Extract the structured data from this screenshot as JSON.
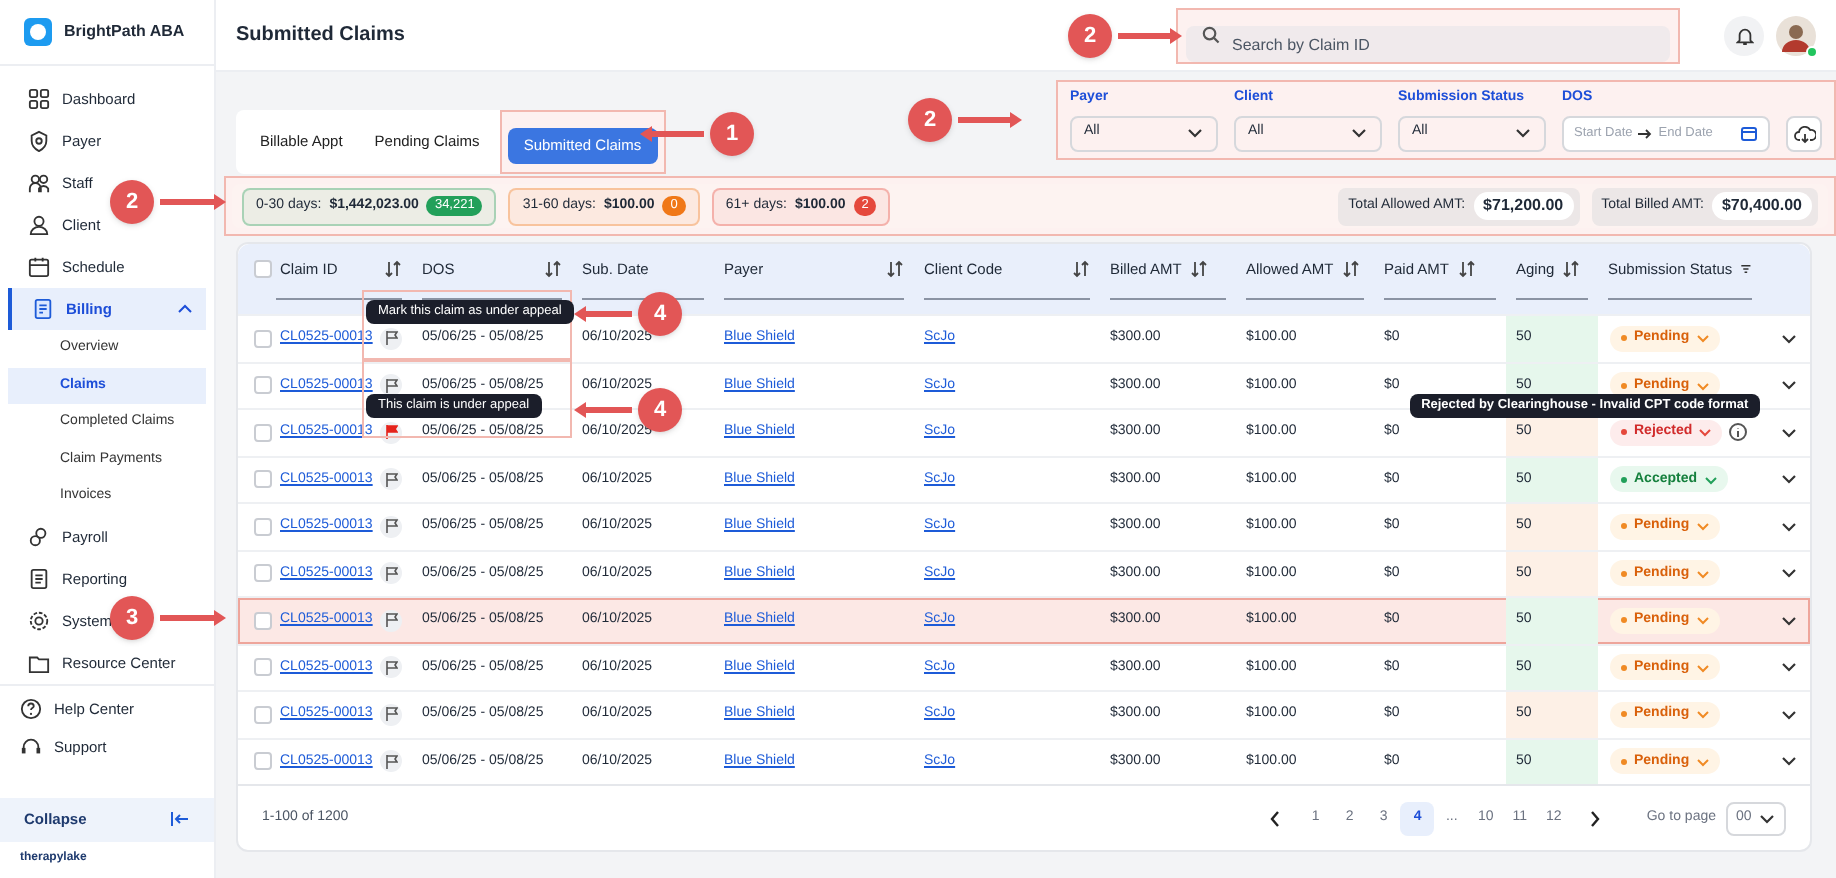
{
  "sidebar": {
    "brand": "BrightPath ABA",
    "items": [
      {
        "label": "Dashboard",
        "selected": false
      },
      {
        "label": "Payer",
        "selected": false
      },
      {
        "label": "Staff",
        "selected": false
      },
      {
        "label": "Client",
        "selected": false
      },
      {
        "label": "Schedule",
        "selected": false
      },
      {
        "label": "Billing",
        "selected": true,
        "expanded": true,
        "children": [
          {
            "label": "Overview",
            "selected": false
          },
          {
            "label": "Claims",
            "selected": true
          },
          {
            "label": "Completed Claims",
            "selected": false
          },
          {
            "label": "Claim Payments",
            "selected": false
          },
          {
            "label": "Invoices",
            "selected": false
          }
        ]
      },
      {
        "label": "Payroll",
        "selected": false
      },
      {
        "label": "Reporting",
        "selected": false
      },
      {
        "label": "System",
        "selected": false
      },
      {
        "label": "Resource Center",
        "selected": false
      }
    ],
    "footer_items": [
      {
        "label": "Help Center"
      },
      {
        "label": "Support"
      }
    ],
    "collapse": "Collapse",
    "vendor": "therapylake"
  },
  "header": {
    "title": "Submitted Claims",
    "search": {
      "placeholder": "Search by Claim ID"
    }
  },
  "tabs": [
    {
      "label": "Billable Appt",
      "selected": false
    },
    {
      "label": "Pending Claims",
      "selected": false
    },
    {
      "label": "Submitted Claims",
      "selected": true
    }
  ],
  "filters": [
    {
      "label": "Payer",
      "value": "All"
    },
    {
      "label": "Client",
      "value": "All"
    },
    {
      "label": "Submission Status",
      "value": "All"
    }
  ],
  "dos_filter": {
    "label": "DOS",
    "start_placeholder": "Start Date",
    "end_placeholder": "End Date"
  },
  "aging_buckets": [
    {
      "label": "0-30 days:",
      "amount": "$1,442,023.00",
      "count": "34,221",
      "color": "#22a05a"
    },
    {
      "label": "31-60 days:",
      "amount": "$100.00",
      "count": "0",
      "color": "#f07818"
    },
    {
      "label": "61+ days:",
      "amount": "$100.00",
      "count": "2",
      "color": "#e5483c"
    }
  ],
  "totals": [
    {
      "label": "Total Allowed AMT:",
      "value": "$71,200.00"
    },
    {
      "label": "Total Billed AMT:",
      "value": "$70,400.00"
    }
  ],
  "table": {
    "all_checked": false,
    "columns": [
      "Claim ID",
      "DOS",
      "Sub. Date",
      "Payer",
      "Client Code",
      "Billed AMT",
      "Allowed AMT",
      "Paid AMT",
      "Aging",
      "Submission Status"
    ],
    "rows": [
      {
        "checked": false,
        "claim_id": "CL0525-00013",
        "appealed": false,
        "flag_tooltip": "Mark this claim as under appeal",
        "dos": "05/06/25 - 05/08/25",
        "sub_date": "06/10/2025",
        "payer": "Blue Shield",
        "client_code": "ScJo",
        "billed": "$300.00",
        "allowed": "$100.00",
        "paid": "$0",
        "aging": "50",
        "color": "#e6f7ec",
        "status": {
          "kind": "pending",
          "label": "Pending"
        },
        "highlighted": false
      },
      {
        "checked": false,
        "claim_id": "CL0525-00013",
        "appealed": false,
        "dos": "05/06/25 - 05/08/25",
        "sub_date": "06/10/2025",
        "payer": "Blue Shield",
        "client_code": "ScJo",
        "billed": "$300.00",
        "allowed": "$100.00",
        "paid": "$0",
        "aging": "50",
        "color": "#e6f7ec",
        "status": {
          "kind": "pending",
          "label": "Pending"
        },
        "highlighted": false
      },
      {
        "checked": false,
        "claim_id": "CL0525-00013",
        "appealed": true,
        "flag_tooltip": "This claim is under appeal",
        "dos": "05/06/25 - 05/08/25",
        "sub_date": "06/10/2025",
        "payer": "Blue Shield",
        "client_code": "ScJo",
        "billed": "$300.00",
        "allowed": "$100.00",
        "paid": "$0",
        "aging": "50",
        "color": "#fdf0e6",
        "status": {
          "kind": "rejected",
          "label": "Rejected"
        },
        "status_tooltip": "Rejected by Clearinghouse - Invalid CPT code format",
        "highlighted": false
      },
      {
        "checked": false,
        "claim_id": "CL0525-00013",
        "appealed": false,
        "dos": "05/06/25 - 05/08/25",
        "sub_date": "06/10/2025",
        "payer": "Blue Shield",
        "client_code": "ScJo",
        "billed": "$300.00",
        "allowed": "$100.00",
        "paid": "$0",
        "aging": "50",
        "color": "#e6f7ec",
        "status": {
          "kind": "accepted",
          "label": "Accepted"
        },
        "highlighted": false
      },
      {
        "checked": false,
        "claim_id": "CL0525-00013",
        "appealed": false,
        "dos": "05/06/25 - 05/08/25",
        "sub_date": "06/10/2025",
        "payer": "Blue Shield",
        "client_code": "ScJo",
        "billed": "$300.00",
        "allowed": "$100.00",
        "paid": "$0",
        "aging": "50",
        "color": "#fdf0e6",
        "status": {
          "kind": "pending",
          "label": "Pending"
        },
        "highlighted": false
      },
      {
        "checked": false,
        "claim_id": "CL0525-00013",
        "appealed": false,
        "dos": "05/06/25 - 05/08/25",
        "sub_date": "06/10/2025",
        "payer": "Blue Shield",
        "client_code": "ScJo",
        "billed": "$300.00",
        "allowed": "$100.00",
        "paid": "$0",
        "aging": "50",
        "color": "#fdf0e6",
        "status": {
          "kind": "pending",
          "label": "Pending"
        },
        "highlighted": false
      },
      {
        "checked": false,
        "claim_id": "CL0525-00013",
        "appealed": false,
        "dos": "05/06/25 - 05/08/25",
        "sub_date": "06/10/2025",
        "payer": "Blue Shield",
        "client_code": "ScJo",
        "billed": "$300.00",
        "allowed": "$100.00",
        "paid": "$0",
        "aging": "50",
        "color": "#e6f7ec",
        "status": {
          "kind": "pending",
          "label": "Pending"
        },
        "highlighted": true
      },
      {
        "checked": false,
        "claim_id": "CL0525-00013",
        "appealed": false,
        "dos": "05/06/25 - 05/08/25",
        "sub_date": "06/10/2025",
        "payer": "Blue Shield",
        "client_code": "ScJo",
        "billed": "$300.00",
        "allowed": "$100.00",
        "paid": "$0",
        "aging": "50",
        "color": "#e6f7ec",
        "status": {
          "kind": "pending",
          "label": "Pending"
        },
        "highlighted": false
      },
      {
        "checked": false,
        "claim_id": "CL0525-00013",
        "appealed": false,
        "dos": "05/06/25 - 05/08/25",
        "sub_date": "06/10/2025",
        "payer": "Blue Shield",
        "client_code": "ScJo",
        "billed": "$300.00",
        "allowed": "$100.00",
        "paid": "$0",
        "aging": "50",
        "color": "#fdf0e6",
        "status": {
          "kind": "pending",
          "label": "Pending"
        },
        "highlighted": false
      },
      {
        "checked": false,
        "claim_id": "CL0525-00013",
        "appealed": false,
        "dos": "05/06/25 - 05/08/25",
        "sub_date": "06/10/2025",
        "payer": "Blue Shield",
        "client_code": "ScJo",
        "billed": "$300.00",
        "allowed": "$100.00",
        "paid": "$0",
        "aging": "50",
        "color": "#e6f7ec",
        "status": {
          "kind": "pending",
          "label": "Pending"
        },
        "highlighted": false
      }
    ]
  },
  "pagination": {
    "range": "1-100 of 1200",
    "pages": [
      {
        "label": "1",
        "selected": false
      },
      {
        "label": "2",
        "selected": false
      },
      {
        "label": "3",
        "selected": false
      },
      {
        "label": "4",
        "selected": true
      },
      {
        "label": "...",
        "selected": false
      },
      {
        "label": "10",
        "selected": false
      },
      {
        "label": "11",
        "selected": false
      },
      {
        "label": "12",
        "selected": false
      }
    ],
    "goto_label": "Go to page",
    "goto_value": "00"
  },
  "annotations": [
    {
      "number": "1"
    },
    {
      "number": "2"
    },
    {
      "number": "2"
    },
    {
      "number": "2"
    },
    {
      "number": "3"
    },
    {
      "number": "4"
    },
    {
      "number": "4"
    }
  ]
}
